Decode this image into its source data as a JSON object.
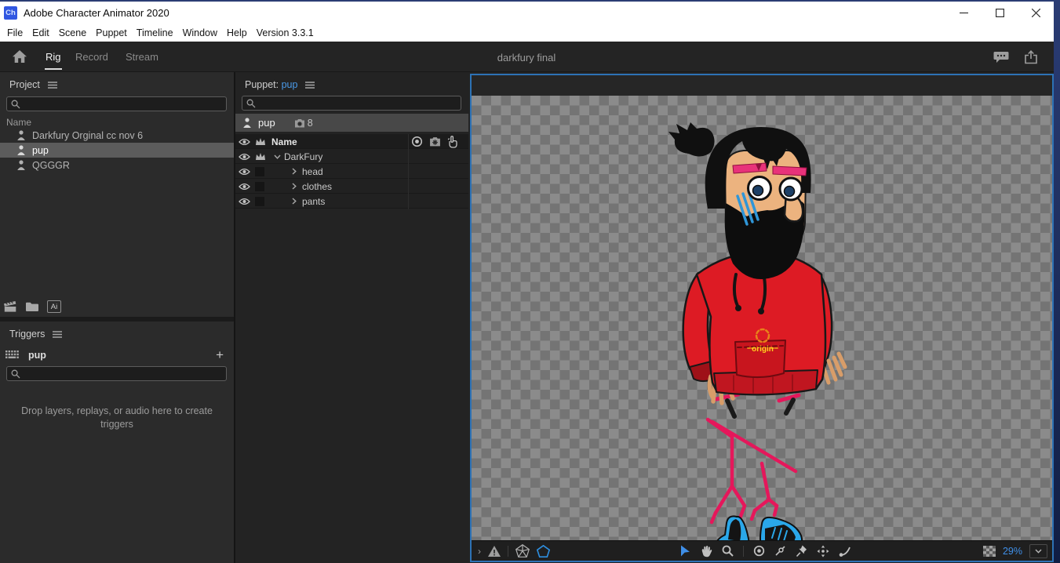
{
  "window": {
    "app_badge": "Ch",
    "title": "Adobe Character Animator 2020"
  },
  "menubar": {
    "items": [
      "File",
      "Edit",
      "Scene",
      "Puppet",
      "Timeline",
      "Window",
      "Help",
      "Version 3.3.1"
    ]
  },
  "workspace": {
    "tabs": [
      {
        "label": "Rig"
      },
      {
        "label": "Record"
      },
      {
        "label": "Stream"
      }
    ],
    "document_title": "darkfury final"
  },
  "project": {
    "title": "Project",
    "name_column": "Name",
    "items": [
      {
        "name": "Darkfury Orginal cc nov 6"
      },
      {
        "name": "pup"
      },
      {
        "name": "QGGGR"
      }
    ]
  },
  "triggers": {
    "title": "Triggers",
    "set_name": "pup",
    "add_button": "+",
    "empty_message": "Drop layers, replays, or audio here to create triggers"
  },
  "puppet": {
    "label_prefix": "Puppet:",
    "name": "pup",
    "row": {
      "name": "pup",
      "behavior_count": "8"
    },
    "tree_header": "Name",
    "tree": [
      {
        "label": "DarkFury"
      },
      {
        "label": "head"
      },
      {
        "label": "clothes"
      },
      {
        "label": "pants"
      }
    ]
  },
  "stage": {
    "origin_label": "origin",
    "zoom_value": "29%"
  },
  "icons": {
    "ai_file_label": "Ai",
    "toolbar_expand_chevron": "›"
  },
  "colors": {
    "accent_blue": "#3f8fe8",
    "puppet_link_blue": "#4a9ae8",
    "stage_border_blue": "#2d72b5",
    "hoodie_red": "#dd1b24",
    "leg_pink": "#e5175b",
    "shoe_blue": "#2aa7e9",
    "eyebrow_pink": "#e8327a",
    "origin_yellow": "#ffd21e",
    "selection_gray": "#5c5c5c"
  }
}
